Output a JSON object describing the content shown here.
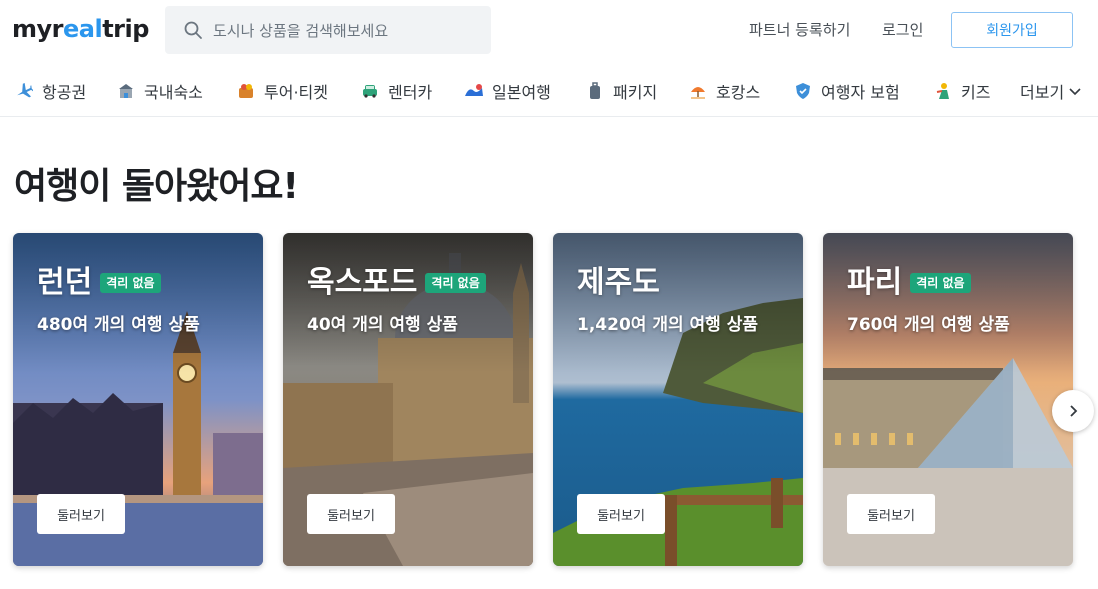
{
  "header": {
    "logo": {
      "part1": "myr",
      "part2": "eal",
      "part3": "trip"
    },
    "search": {
      "placeholder": "도시나 상품을 검색해보세요",
      "icon": "search-icon"
    },
    "partner_link": "파트너 등록하기",
    "login_link": "로그인",
    "signup_button": "회원가입"
  },
  "nav": {
    "items": [
      {
        "label": "항공권",
        "icon": "airplane-icon"
      },
      {
        "label": "국내숙소",
        "icon": "hotel-icon"
      },
      {
        "label": "투어·티켓",
        "icon": "ticket-icon"
      },
      {
        "label": "렌터카",
        "icon": "car-icon"
      },
      {
        "label": "일본여행",
        "icon": "wave-icon"
      },
      {
        "label": "패키지",
        "icon": "luggage-icon"
      },
      {
        "label": "호캉스",
        "icon": "umbrella-icon"
      },
      {
        "label": "여행자 보험",
        "icon": "shield-icon"
      },
      {
        "label": "키즈",
        "icon": "kids-icon"
      }
    ],
    "more_label": "더보기"
  },
  "main": {
    "title": "여행이 돌아왔어요!",
    "cards": [
      {
        "city": "런던",
        "badge": "격리 없음",
        "count": "480여 개의 여행 상품",
        "button": "둘러보기"
      },
      {
        "city": "옥스포드",
        "badge": "격리 없음",
        "count": "40여 개의 여행 상품",
        "button": "둘러보기"
      },
      {
        "city": "제주도",
        "badge": "",
        "count": "1,420여 개의 여행 상품",
        "button": "둘러보기"
      },
      {
        "city": "파리",
        "badge": "격리 없음",
        "count": "760여 개의 여행 상품",
        "button": "둘러보기"
      }
    ],
    "next_icon": "chevron-right-icon"
  },
  "colors": {
    "brand": "#2b96ed",
    "badge": "#1da57a",
    "text": "#343a40"
  }
}
